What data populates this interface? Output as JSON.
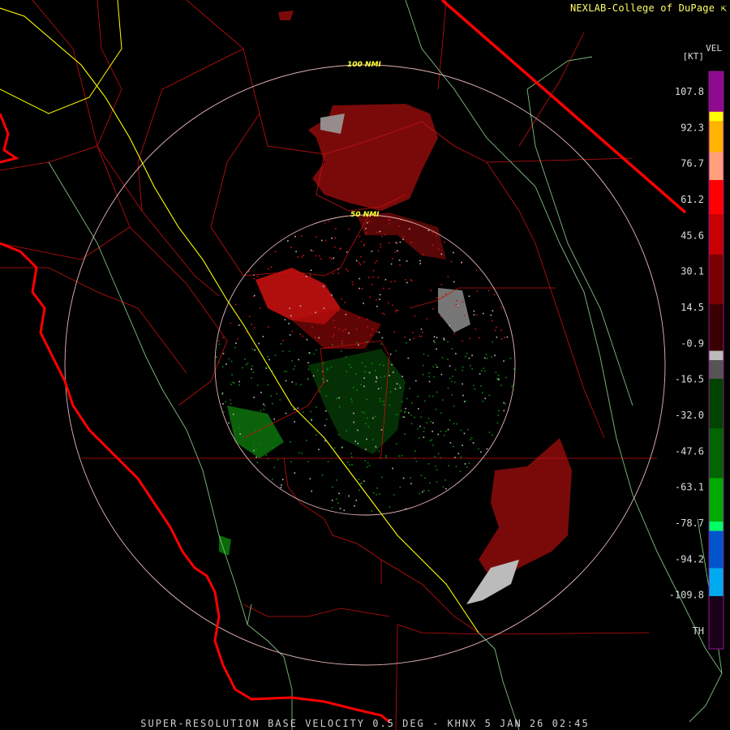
{
  "header": {
    "credit": "NEXLAB-College of DuPage",
    "credit_icon": "cursor-arrow-icon"
  },
  "legend": {
    "title": "VEL",
    "unit": "[KT]",
    "ticks": [
      "107.8",
      "92.3",
      "76.7",
      "61.2",
      "45.6",
      "30.1",
      "14.5",
      "-0.9",
      "-16.5",
      "-32.0",
      "-47.6",
      "-63.1",
      "-78.7",
      "-94.2",
      "-109.8",
      "TH"
    ],
    "bands": [
      {
        "color": "#8e0a8e",
        "span": 0.065
      },
      {
        "color": "#ffff00",
        "span": 0.015
      },
      {
        "color": "#ffb400",
        "span": 0.05
      },
      {
        "color": "#ffa07a",
        "span": 0.045
      },
      {
        "color": "#ff0000",
        "span": 0.055
      },
      {
        "color": "#c80000",
        "span": 0.065
      },
      {
        "color": "#7a0000",
        "span": 0.08
      },
      {
        "color": "#3a0000",
        "span": 0.075
      },
      {
        "color": "#bbbbbb",
        "span": 0.015
      },
      {
        "color": "#555555",
        "span": 0.03
      },
      {
        "color": "#004400",
        "span": 0.08
      },
      {
        "color": "#006600",
        "span": 0.08
      },
      {
        "color": "#00aa00",
        "span": 0.07
      },
      {
        "color": "#00ff66",
        "span": 0.015
      },
      {
        "color": "#0055cc",
        "span": 0.06
      },
      {
        "color": "#00aaee",
        "span": 0.045
      },
      {
        "color": "#1a0018",
        "span": 0.085
      }
    ]
  },
  "rings": [
    {
      "label": "100 NMI"
    },
    {
      "label": "50 NMI"
    }
  ],
  "footer": {
    "product": "SUPER-RESOLUTION BASE VELOCITY 0.5 DEG - KHNX 5 JAN 26 02:45"
  },
  "colors": {
    "state_border": "#ff0000",
    "county": "#cc1111",
    "interstate": "#ffff00",
    "range_ring": "#ffcccc",
    "river": "#88cc88"
  }
}
